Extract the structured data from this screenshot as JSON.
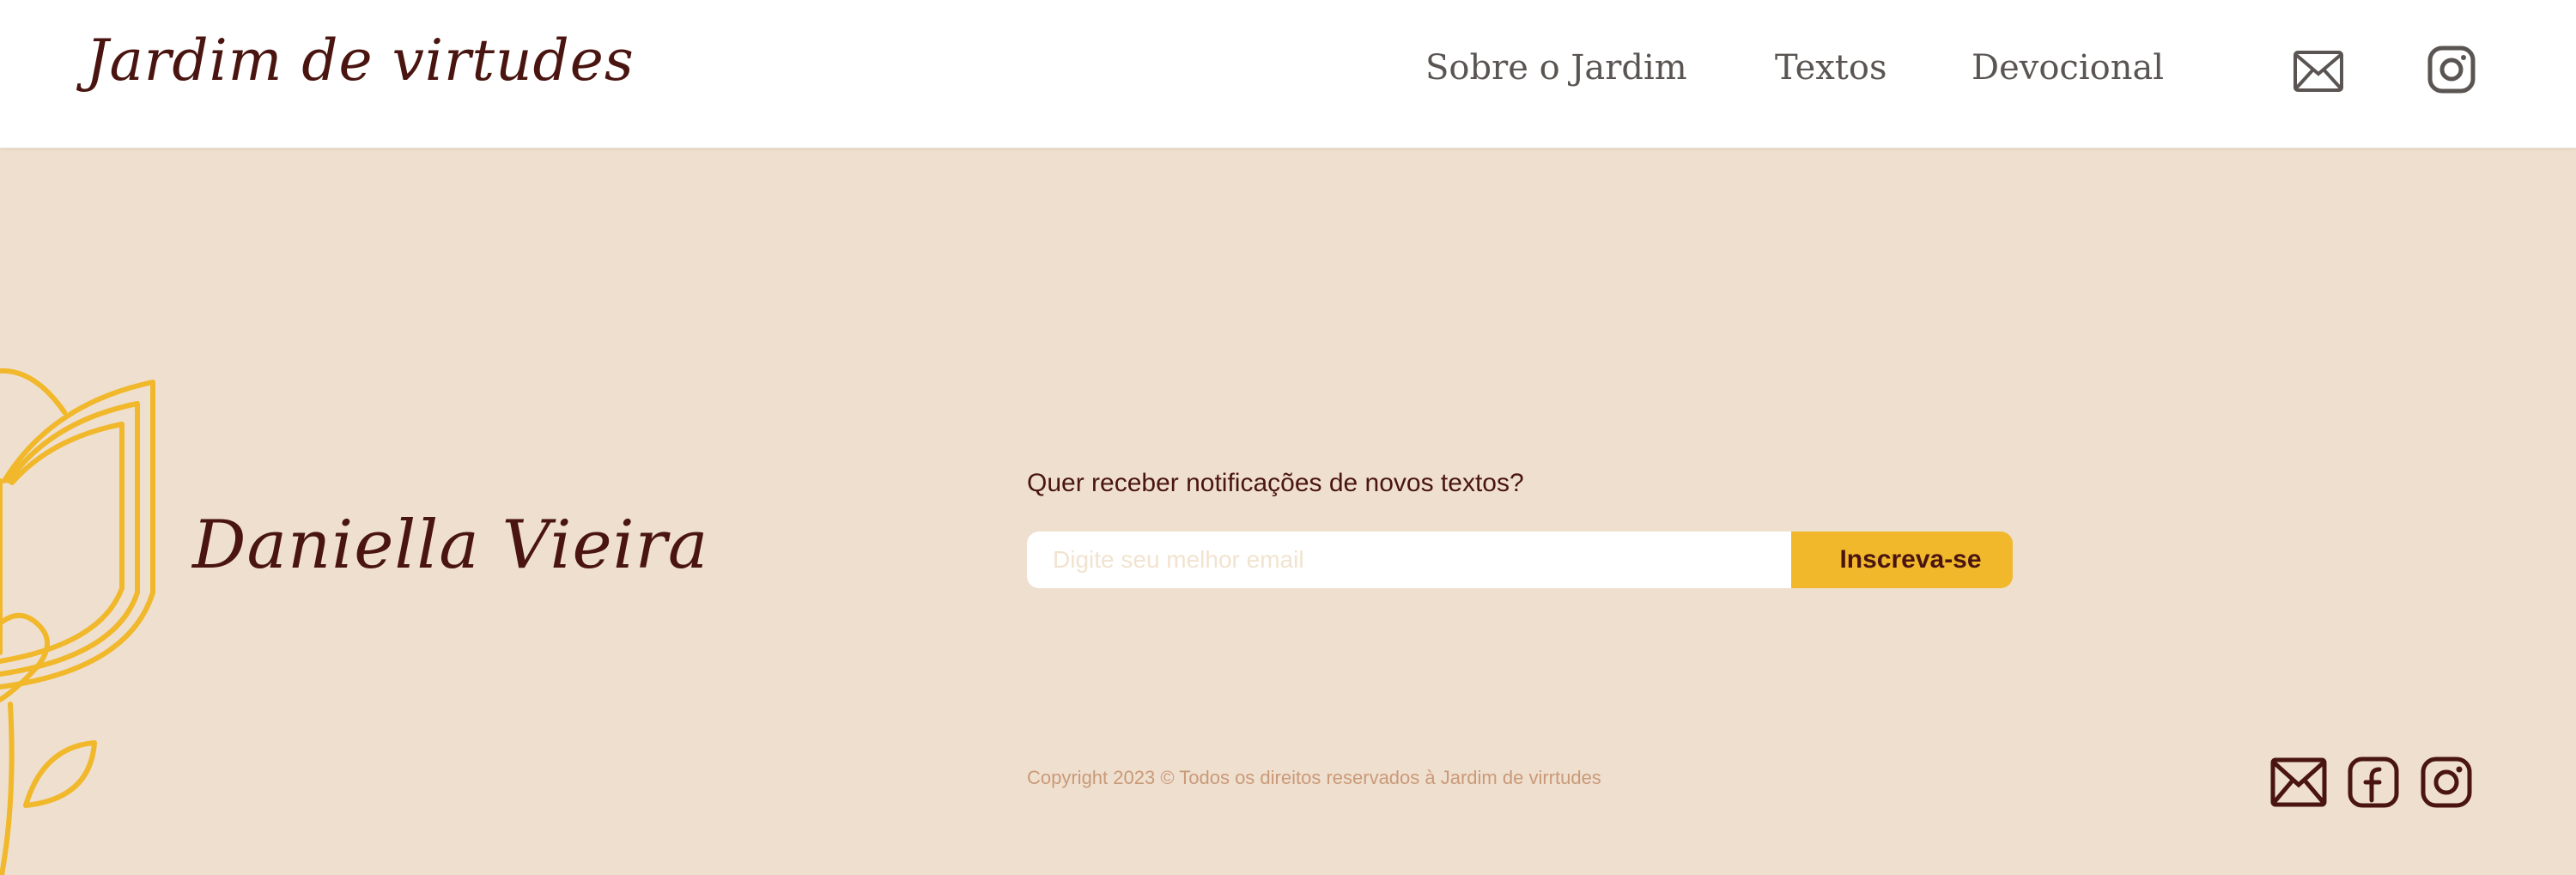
{
  "header": {
    "logo": "Jardim de virtudes",
    "nav": [
      {
        "label": "Sobre o Jardim"
      },
      {
        "label": "Textos"
      },
      {
        "label": "Devocional"
      }
    ],
    "icons": [
      "mail-icon",
      "instagram-icon"
    ]
  },
  "hero": {
    "author": "Daniella Vieira"
  },
  "newsletter": {
    "question": "Quer receber notificações de novos textos?",
    "email_placeholder": "Digite seu melhor email",
    "email_value": "",
    "subscribe_label": "Inscreva-se"
  },
  "footer": {
    "copyright": "Copyright 2023 © Todos os direitos reservados à Jardim de virrtudes",
    "icons": [
      "mail-icon",
      "facebook-icon",
      "instagram-icon"
    ]
  },
  "colors": {
    "background": "#efdfcf",
    "brand_dark": "#4a1510",
    "accent": "#f0b82a",
    "nav_text": "#5a5552",
    "copyright_text": "#c99a78"
  }
}
